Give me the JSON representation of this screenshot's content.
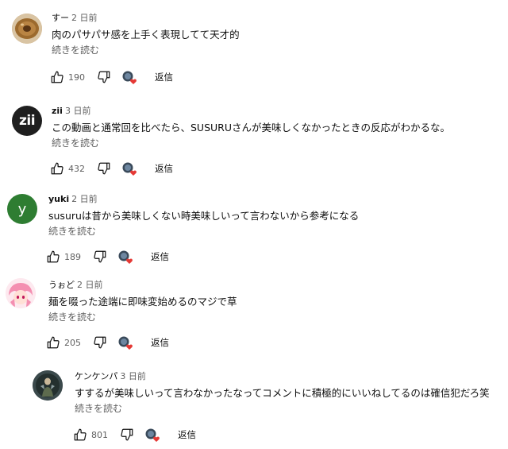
{
  "comments": [
    {
      "author": "すー",
      "time": "2 日前",
      "text": "肉のパサパサ感を上手く表現してて天才的",
      "more": "続きを読む",
      "likes": "190",
      "reply": "返信",
      "avatar": "avatar-cookie"
    },
    {
      "author": "zii",
      "time": "3 日前",
      "text": "この動画と通常回を比べたら、SUSURUさんが美味しくなかったときの反応がわかるな。",
      "more": "続きを読む",
      "likes": "432",
      "reply": "返信",
      "avatar_text": "zii"
    },
    {
      "author": "yuki",
      "time": "2 日前",
      "text": "susuruは昔から美味しくない時美味しいって言わないから参考になる",
      "more": "続きを読む",
      "likes": "189",
      "reply": "返信",
      "avatar_text": "y"
    },
    {
      "author": "うぉど",
      "time": "2 日前",
      "text": "麺を啜った途端に即味変始めるのマジで草",
      "more": "続きを読む",
      "likes": "205",
      "reply": "返信",
      "avatar": "avatar-anime"
    },
    {
      "author": "ケンケンパ",
      "time": "3 日前",
      "text": "すするが美味しいって言わなかったなってコメントに積極的にいいねしてるのは確信犯だろ笑",
      "more": "続きを読む",
      "likes": "801",
      "reply": "返信",
      "avatar": "avatar-figure"
    }
  ],
  "colors": {
    "zii_avatar_bg": "#1f1f1f",
    "yuki_avatar_bg": "#2e7d32",
    "heart": "#e53935"
  }
}
